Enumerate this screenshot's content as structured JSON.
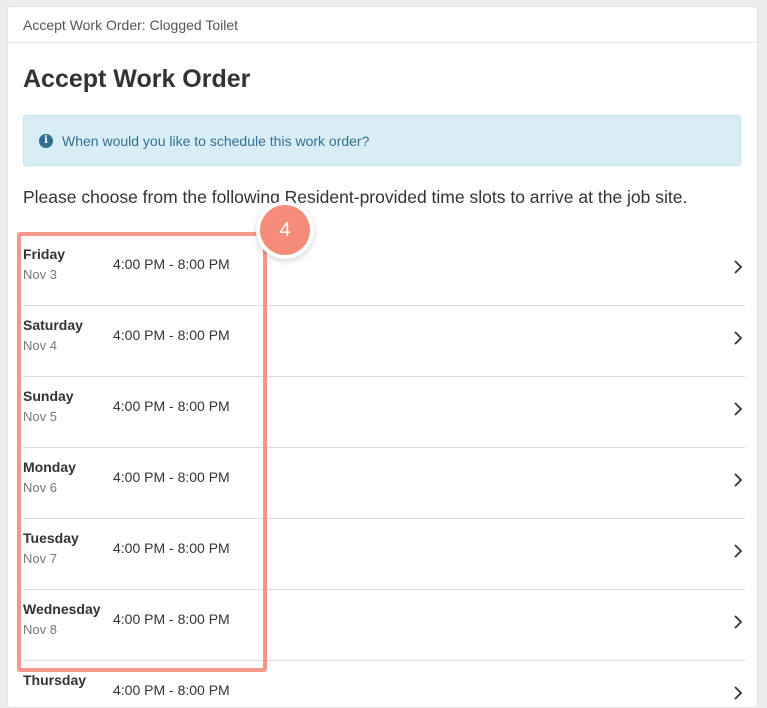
{
  "header": {
    "title": "Accept Work Order: Clogged Toilet"
  },
  "page": {
    "title": "Accept Work Order",
    "alert": {
      "icon": "info-circle-icon",
      "text": "When would you like to schedule this work order?"
    },
    "intro": "Please choose from the following Resident-provided time slots to arrive at the job site."
  },
  "slots": [
    {
      "day": "Friday",
      "date": "Nov 3",
      "time": "4:00 PM - 8:00 PM"
    },
    {
      "day": "Saturday",
      "date": "Nov 4",
      "time": "4:00 PM - 8:00 PM"
    },
    {
      "day": "Sunday",
      "date": "Nov 5",
      "time": "4:00 PM - 8:00 PM"
    },
    {
      "day": "Monday",
      "date": "Nov 6",
      "time": "4:00 PM - 8:00 PM"
    },
    {
      "day": "Tuesday",
      "date": "Nov 7",
      "time": "4:00 PM - 8:00 PM"
    },
    {
      "day": "Wednesday",
      "date": "Nov 8",
      "time": "4:00 PM - 8:00 PM"
    },
    {
      "day": "Thursday",
      "date": "",
      "time": "4:00 PM - 8:00 PM"
    }
  ],
  "annotation": {
    "step": "4",
    "color": "#f58c78"
  },
  "colors": {
    "alert_bg": "#d9edf7",
    "alert_text": "#31708f",
    "highlight": "#f4978a"
  }
}
